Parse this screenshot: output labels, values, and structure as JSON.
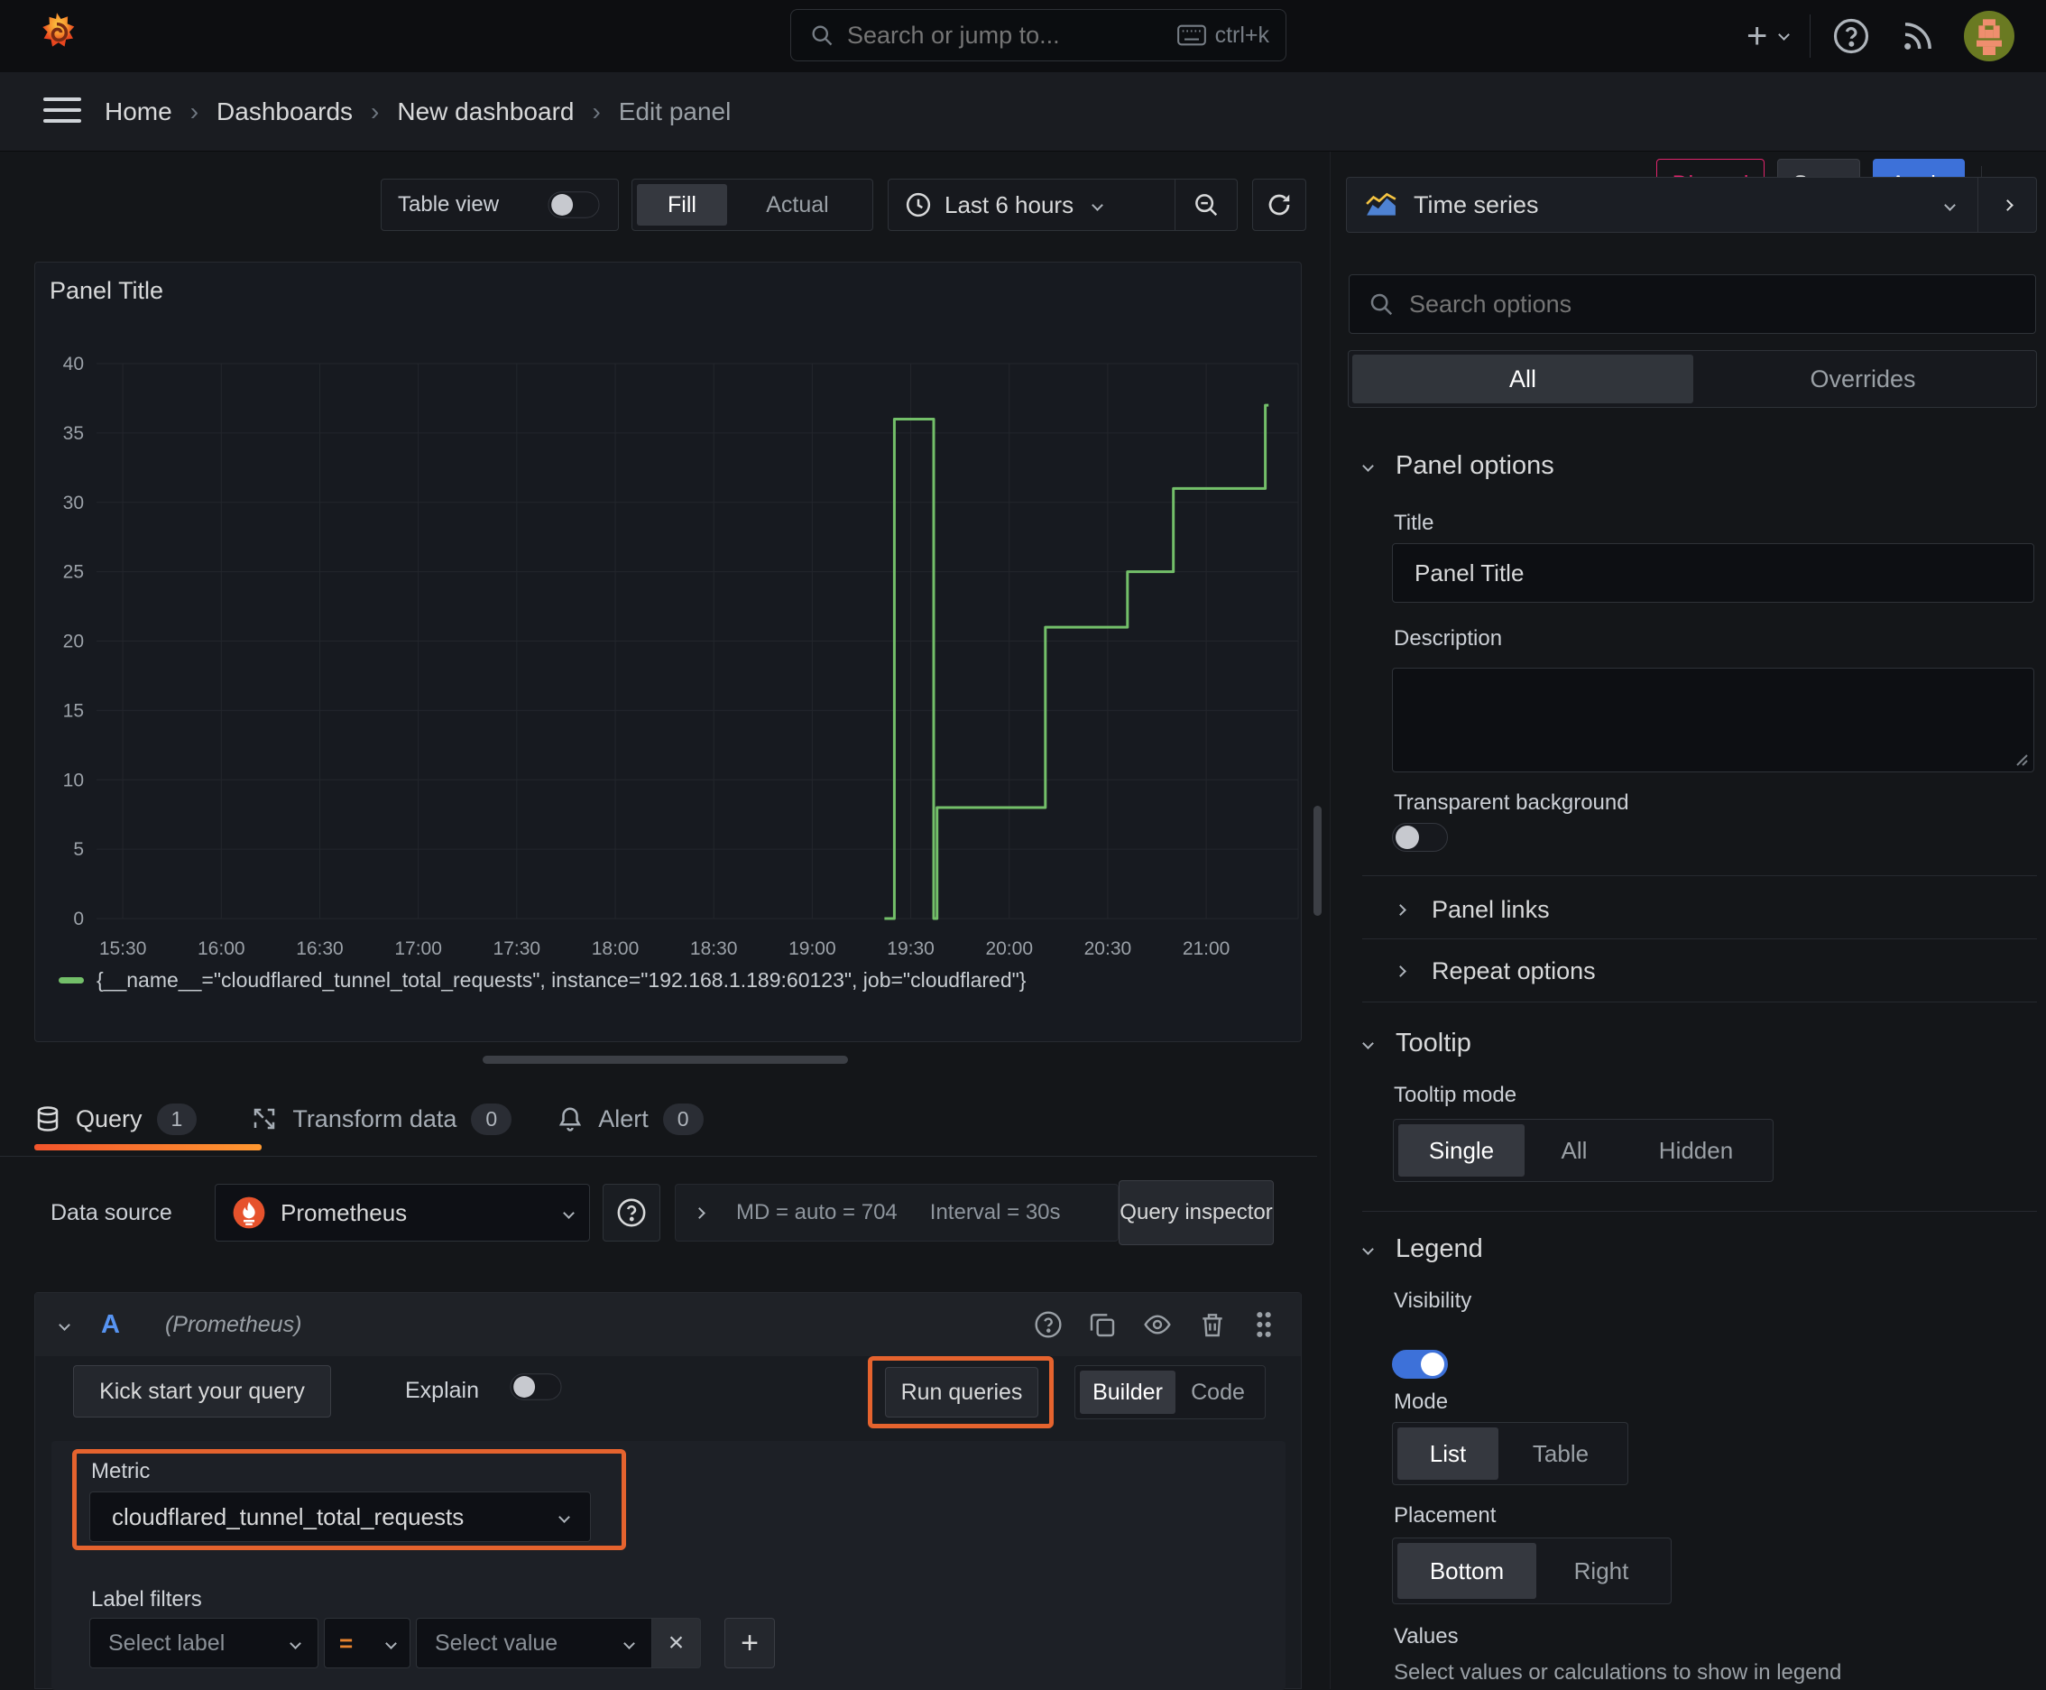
{
  "topnav": {
    "search_placeholder": "Search or jump to...",
    "shortcut": "ctrl+k"
  },
  "breadcrumb": {
    "items": [
      "Home",
      "Dashboards",
      "New dashboard",
      "Edit panel"
    ],
    "separator": "›"
  },
  "header_actions": {
    "discard": "Discard",
    "save": "Save",
    "apply": "Apply"
  },
  "toolbar": {
    "table_view": "Table view",
    "fill": "Fill",
    "actual": "Actual",
    "time_range": "Last 6 hours"
  },
  "viz_picker": {
    "label": "Time series"
  },
  "panel": {
    "title": "Panel Title"
  },
  "chart_data": {
    "type": "line",
    "line_style": "step-after",
    "title": "Panel Title",
    "x_domain_minutes": [
      22,
      388
    ],
    "y_domain": [
      0,
      40
    ],
    "y_ticks": [
      0,
      5,
      10,
      15,
      20,
      25,
      30,
      35,
      40
    ],
    "x_ticks": [
      {
        "m": 30,
        "label": "15:30"
      },
      {
        "m": 60,
        "label": "16:00"
      },
      {
        "m": 90,
        "label": "16:30"
      },
      {
        "m": 120,
        "label": "17:00"
      },
      {
        "m": 150,
        "label": "17:30"
      },
      {
        "m": 180,
        "label": "18:00"
      },
      {
        "m": 210,
        "label": "18:30"
      },
      {
        "m": 240,
        "label": "19:00"
      },
      {
        "m": 270,
        "label": "19:30"
      },
      {
        "m": 300,
        "label": "20:00"
      },
      {
        "m": 330,
        "label": "20:30"
      },
      {
        "m": 360,
        "label": "21:00"
      }
    ],
    "series": [
      {
        "name": "{__name__=\"cloudflared_tunnel_total_requests\", instance=\"192.168.1.189:60123\", job=\"cloudflared\"}",
        "color": "#73bf69",
        "points_minutes_value": [
          [
            262,
            0
          ],
          [
            265,
            36
          ],
          [
            277,
            0
          ],
          [
            278,
            8
          ],
          [
            311,
            21
          ],
          [
            336,
            25
          ],
          [
            350,
            31
          ],
          [
            378,
            37
          ],
          [
            379,
            37
          ]
        ]
      }
    ],
    "legend_position": "bottom",
    "grid": true
  },
  "query_tabs": {
    "query": "Query",
    "query_badge": "1",
    "transform": "Transform data",
    "transform_badge": "0",
    "alert": "Alert",
    "alert_badge": "0"
  },
  "datasource_row": {
    "label": "Data source",
    "name": "Prometheus",
    "options_summary": "MD = auto = 704",
    "interval": "Interval = 30s",
    "query_inspector": "Query inspector"
  },
  "query_row": {
    "letter": "A",
    "datasource_hint": "(Prometheus)"
  },
  "query_editor": {
    "kickstart": "Kick start your query",
    "explain": "Explain",
    "run_queries": "Run queries",
    "builder": "Builder",
    "code": "Code",
    "metric_label": "Metric",
    "metric_value": "cloudflared_tunnel_total_requests",
    "label_filters_label": "Label filters",
    "select_label": "Select label",
    "operator": "=",
    "select_value": "Select value",
    "remove": "×",
    "add": "+"
  },
  "options_pane": {
    "search_placeholder": "Search options",
    "tab_all": "All",
    "tab_overrides": "Overrides",
    "panel_options": {
      "header": "Panel options",
      "title_label": "Title",
      "title_value": "Panel Title",
      "description_label": "Description",
      "transparent_label": "Transparent background",
      "panel_links": "Panel links",
      "repeat_options": "Repeat options"
    },
    "tooltip": {
      "header": "Tooltip",
      "mode_label": "Tooltip mode",
      "single": "Single",
      "all": "All",
      "hidden": "Hidden"
    },
    "legend": {
      "header": "Legend",
      "visibility_label": "Visibility",
      "mode_label": "Mode",
      "list": "List",
      "table": "Table",
      "placement_label": "Placement",
      "bottom": "Bottom",
      "right": "Right",
      "values_label": "Values",
      "values_hint": "Select values or calculations to show in legend"
    }
  },
  "colors": {
    "accent_orange": "#e5632e",
    "series_green": "#73bf69",
    "primary_blue": "#3d71d9",
    "discard_pink": "#e0246c",
    "tab_underline": "#ff8833"
  }
}
